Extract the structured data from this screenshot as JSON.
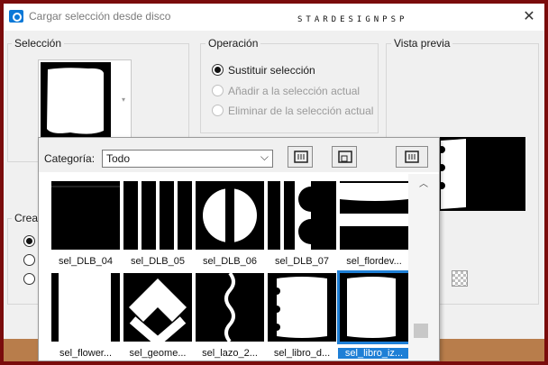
{
  "window": {
    "title": "Cargar selección desde disco",
    "watermark": "STARDESIGNPSP"
  },
  "sections": {
    "seleccion": "Selección",
    "operacion": "Operación",
    "vista_previa": "Vista previa",
    "crear_partial": "Crea"
  },
  "operation": {
    "options": [
      {
        "label": "Sustituir selección",
        "selected": true,
        "enabled": true
      },
      {
        "label": "Añadir a la selección actual",
        "selected": false,
        "enabled": false
      },
      {
        "label": "Eliminar de la selección actual",
        "selected": false,
        "enabled": false
      }
    ]
  },
  "popup": {
    "category_label": "Categoría:",
    "category_value": "Todo",
    "items": [
      {
        "name": "sel_DLB_04",
        "selected": false
      },
      {
        "name": "sel_DLB_05",
        "selected": false
      },
      {
        "name": "sel_DLB_06",
        "selected": false
      },
      {
        "name": "sel_DLB_07",
        "selected": false
      },
      {
        "name": "sel_flordev...",
        "selected": false
      },
      {
        "name": "sel_flower...",
        "selected": false
      },
      {
        "name": "sel_geome...",
        "selected": false
      },
      {
        "name": "sel_lazo_2...",
        "selected": false
      },
      {
        "name": "sel_libro_d...",
        "selected": false
      },
      {
        "name": "sel_libro_iz...",
        "selected": true
      }
    ]
  },
  "colors": {
    "accent": "#1e7fd6",
    "frame": "#7a0c0c",
    "floor": "#b87d4b"
  }
}
